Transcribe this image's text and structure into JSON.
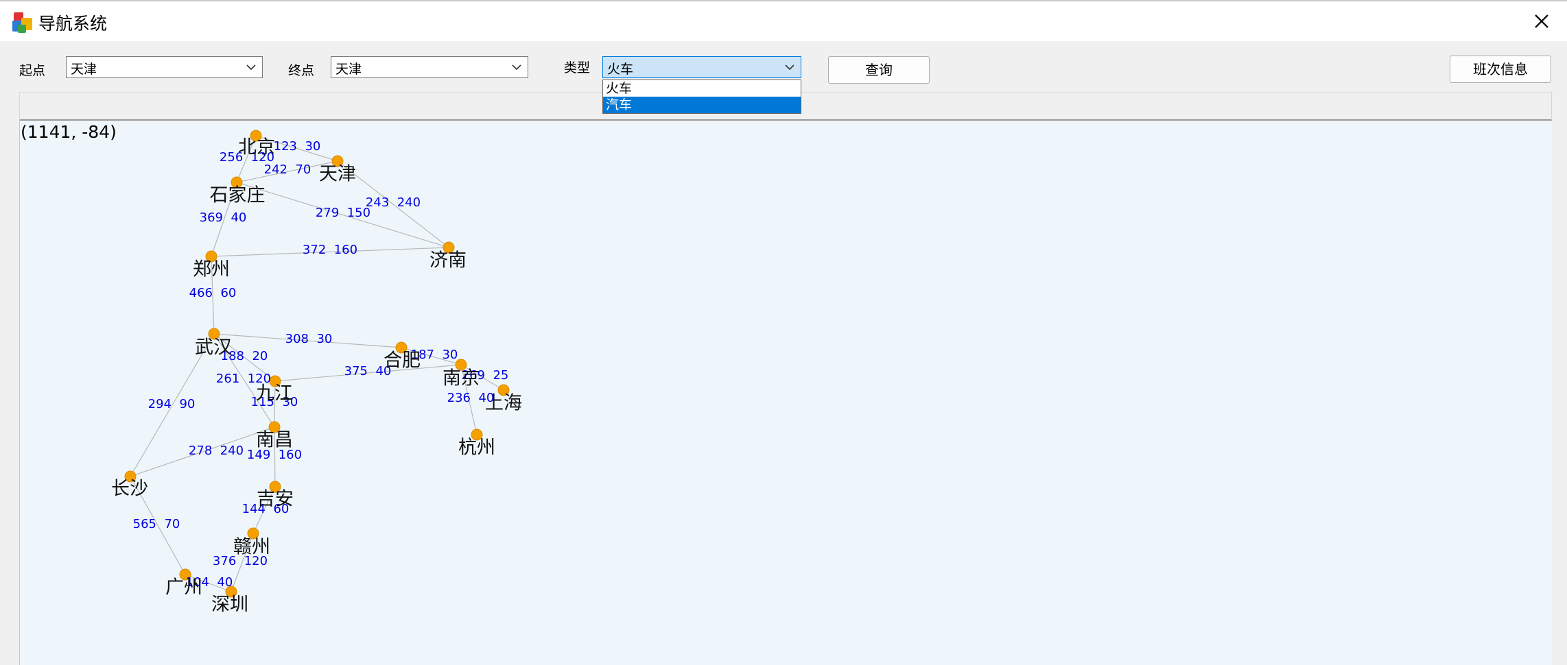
{
  "window": {
    "title": "导航系统",
    "app_icon": "app-icon",
    "close_icon": "close-icon"
  },
  "toolbar": {
    "start_label": "起点",
    "start_value": "天津",
    "end_label": "终点",
    "end_value": "天津",
    "type_label": "类型",
    "type_value": "火车",
    "query_button": "查询",
    "schedule_button": "班次信息"
  },
  "dropdown": {
    "options": [
      "火车",
      "汽车"
    ],
    "highlighted": "汽车"
  },
  "map": {
    "coordinate_readout": "(1141, -84)",
    "cities": [
      {
        "id": "beijing",
        "name": "北京"
      },
      {
        "id": "tianjin",
        "name": "天津"
      },
      {
        "id": "shijiazhuang",
        "name": "石家庄"
      },
      {
        "id": "jinan",
        "name": "济南"
      },
      {
        "id": "zhengzhou",
        "name": "郑州"
      },
      {
        "id": "wuhan",
        "name": "武汉"
      },
      {
        "id": "hefei",
        "name": "合肥"
      },
      {
        "id": "nanjing",
        "name": "南京"
      },
      {
        "id": "shanghai",
        "name": "上海"
      },
      {
        "id": "hangzhou",
        "name": "杭州"
      },
      {
        "id": "jiujiang",
        "name": "九江"
      },
      {
        "id": "nanchang",
        "name": "南昌"
      },
      {
        "id": "changsha",
        "name": "长沙"
      },
      {
        "id": "jian",
        "name": "吉安"
      },
      {
        "id": "ganzhou",
        "name": "赣州"
      },
      {
        "id": "guangzhou",
        "name": "广州"
      },
      {
        "id": "shenzhen",
        "name": "深圳"
      }
    ],
    "routes": [
      {
        "from": "beijing",
        "to": "tianjin",
        "label": "123  30"
      },
      {
        "from": "beijing",
        "to": "shijiazhuang",
        "label": "256  120"
      },
      {
        "from": "shijiazhuang",
        "to": "tianjin",
        "label": "242  70"
      },
      {
        "from": "tianjin",
        "to": "jinan",
        "label": "243  240"
      },
      {
        "from": "shijiazhuang",
        "to": "jinan",
        "label": "279  150"
      },
      {
        "from": "shijiazhuang",
        "to": "zhengzhou",
        "label": "369  40"
      },
      {
        "from": "zhengzhou",
        "to": "jinan",
        "label": "372  160"
      },
      {
        "from": "zhengzhou",
        "to": "wuhan",
        "label": "466  60"
      },
      {
        "from": "wuhan",
        "to": "hefei",
        "label": "308  30"
      },
      {
        "from": "hefei",
        "to": "nanjing",
        "label": "187  30"
      },
      {
        "from": "nanjing",
        "to": "shanghai",
        "label": "269  25"
      },
      {
        "from": "nanjing",
        "to": "hangzhou",
        "label": "236  40"
      },
      {
        "from": "jiujiang",
        "to": "nanjing",
        "label": "375  40"
      },
      {
        "from": "wuhan",
        "to": "jiujiang",
        "label": "188  20"
      },
      {
        "from": "wuhan",
        "to": "nanchang",
        "label": "261  120"
      },
      {
        "from": "jiujiang",
        "to": "nanchang",
        "label": "115  30"
      },
      {
        "from": "wuhan",
        "to": "changsha",
        "label": "294  90"
      },
      {
        "from": "changsha",
        "to": "nanchang",
        "label": "278  240"
      },
      {
        "from": "nanchang",
        "to": "jian",
        "label": "149  160"
      },
      {
        "from": "jian",
        "to": "ganzhou",
        "label": "144  60"
      },
      {
        "from": "changsha",
        "to": "guangzhou",
        "label": "565  70"
      },
      {
        "from": "ganzhou",
        "to": "shenzhen",
        "label": "376  120"
      },
      {
        "from": "guangzhou",
        "to": "shenzhen",
        "label": "104  40"
      }
    ],
    "colors": {
      "node": "#f5a000",
      "node_edge": "#d98b00",
      "edge": "#b8b8b8",
      "route_label": "#0000e0",
      "background": "#eef6fb"
    }
  }
}
